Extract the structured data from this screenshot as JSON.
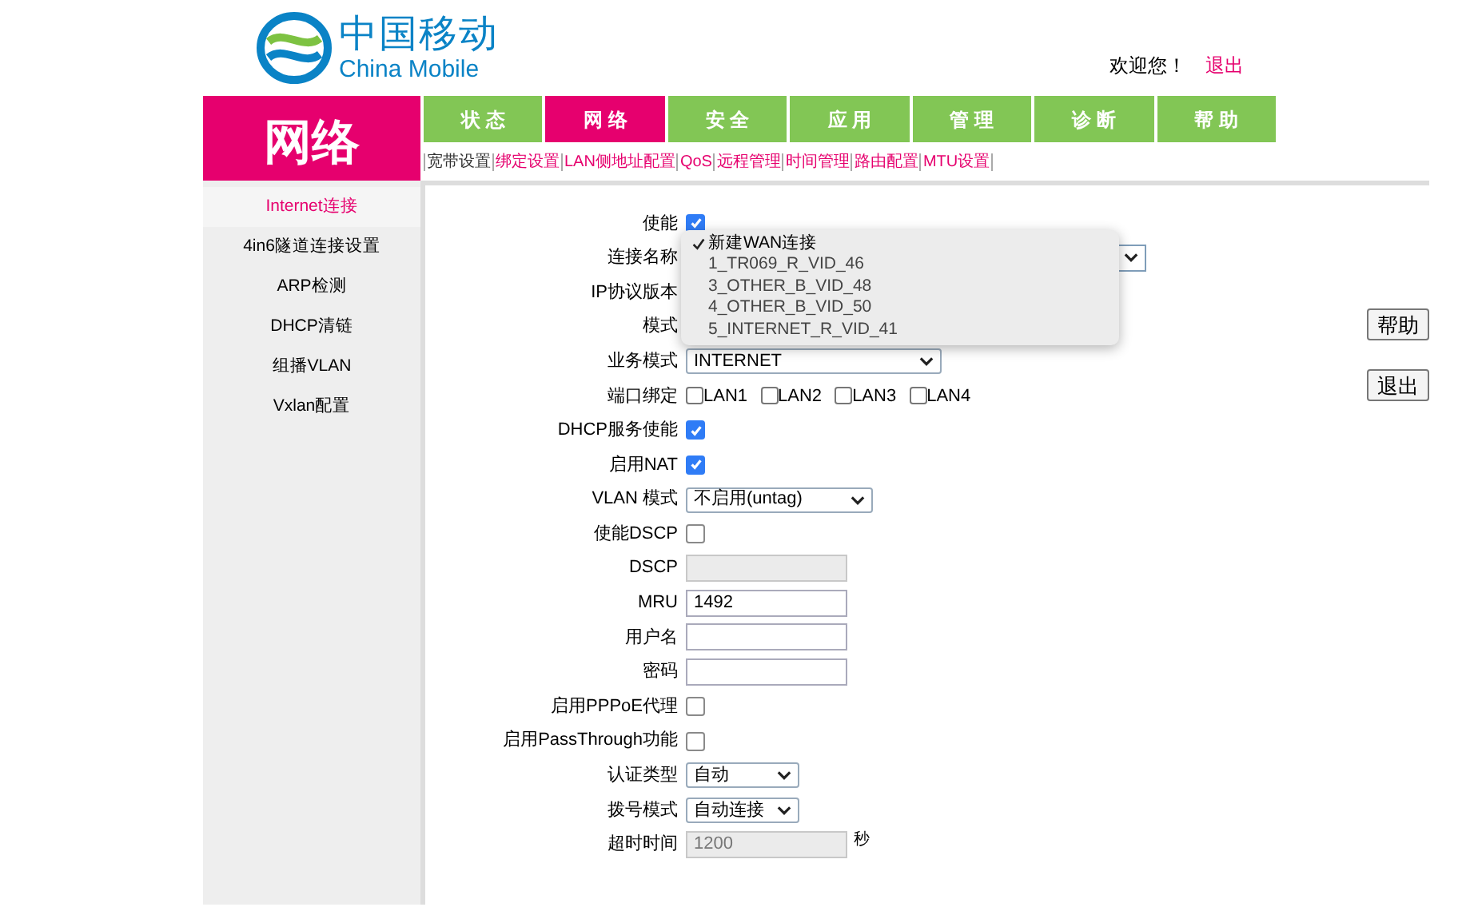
{
  "logo": {
    "name_cn": "中国移动",
    "name_en": "China Mobile"
  },
  "header": {
    "welcome": "欢迎您！",
    "logout": "退出"
  },
  "section_title": "网络",
  "tabs": [
    {
      "label": "状 态",
      "selected": false
    },
    {
      "label": "网 络",
      "selected": true
    },
    {
      "label": "安 全",
      "selected": false
    },
    {
      "label": "应 用",
      "selected": false
    },
    {
      "label": "管 理",
      "selected": false
    },
    {
      "label": "诊 断",
      "selected": false
    },
    {
      "label": "帮 助",
      "selected": false
    }
  ],
  "subnav": [
    {
      "label": "宽带设置",
      "selected": true
    },
    {
      "label": "绑定设置",
      "selected": false
    },
    {
      "label": "LAN侧地址配置",
      "selected": false
    },
    {
      "label": "QoS",
      "selected": false
    },
    {
      "label": "远程管理",
      "selected": false
    },
    {
      "label": "时间管理",
      "selected": false
    },
    {
      "label": "路由配置",
      "selected": false
    },
    {
      "label": "MTU设置",
      "selected": false
    }
  ],
  "sidebar": {
    "items": [
      {
        "label": "Internet连接",
        "selected": true
      },
      {
        "label": "4in6隧道连接设置",
        "selected": false
      },
      {
        "label": "ARP检测",
        "selected": false
      },
      {
        "label": "DHCP清链",
        "selected": false
      },
      {
        "label": "组播VLAN",
        "selected": false
      },
      {
        "label": "Vxlan配置",
        "selected": false
      }
    ]
  },
  "form": {
    "rows": [
      {
        "kind": "checkbox",
        "label": "使能",
        "checked": true
      },
      {
        "kind": "connection",
        "label": "连接名称"
      },
      {
        "kind": "hidden",
        "label": "IP协议版本"
      },
      {
        "kind": "hidden",
        "label": "模式"
      },
      {
        "kind": "select_wide",
        "label": "业务模式",
        "value": "INTERNET"
      },
      {
        "kind": "ports",
        "label": "端口绑定",
        "ports": [
          {
            "label": "LAN1",
            "checked": false
          },
          {
            "label": "LAN2",
            "checked": false
          },
          {
            "label": "LAN3",
            "checked": false
          },
          {
            "label": "LAN4",
            "checked": false
          }
        ]
      },
      {
        "kind": "checkbox",
        "label": "DHCP服务使能",
        "checked": true
      },
      {
        "kind": "checkbox",
        "label": "启用NAT",
        "checked": true
      },
      {
        "kind": "select",
        "label": "VLAN 模式",
        "value": "不启用(untag)"
      },
      {
        "kind": "checkbox",
        "label": "使能DSCP",
        "checked": false
      },
      {
        "kind": "text",
        "label": "DSCP",
        "disabled": true
      },
      {
        "kind": "text",
        "label": "MRU",
        "value": "1492",
        "disabled": false
      },
      {
        "kind": "text",
        "label": "用户名",
        "disabled": false
      },
      {
        "kind": "text",
        "label": "密码",
        "disabled": false
      },
      {
        "kind": "checkbox",
        "label": "启用PPPoE代理",
        "checked": false
      },
      {
        "kind": "checkbox",
        "label": "启用PassThrough功能",
        "checked": false
      },
      {
        "kind": "select_small",
        "label": "认证类型",
        "value": "自动"
      },
      {
        "kind": "select_small",
        "label": "拨号模式",
        "value": "自动连接"
      },
      {
        "kind": "text",
        "label": "超时时间",
        "value": "1200",
        "disabled": true,
        "unit": "秒"
      }
    ]
  },
  "connection_menu": [
    {
      "label": "新建WAN连接",
      "selected": true
    },
    {
      "label": "1_TR069_R_VID_46",
      "selected": false
    },
    {
      "label": "3_OTHER_B_VID_48",
      "selected": false
    },
    {
      "label": "4_OTHER_B_VID_50",
      "selected": false
    },
    {
      "label": "5_INTERNET_R_VID_41",
      "selected": false
    }
  ],
  "buttons": [
    {
      "label": "帮助"
    },
    {
      "label": "退出"
    }
  ]
}
